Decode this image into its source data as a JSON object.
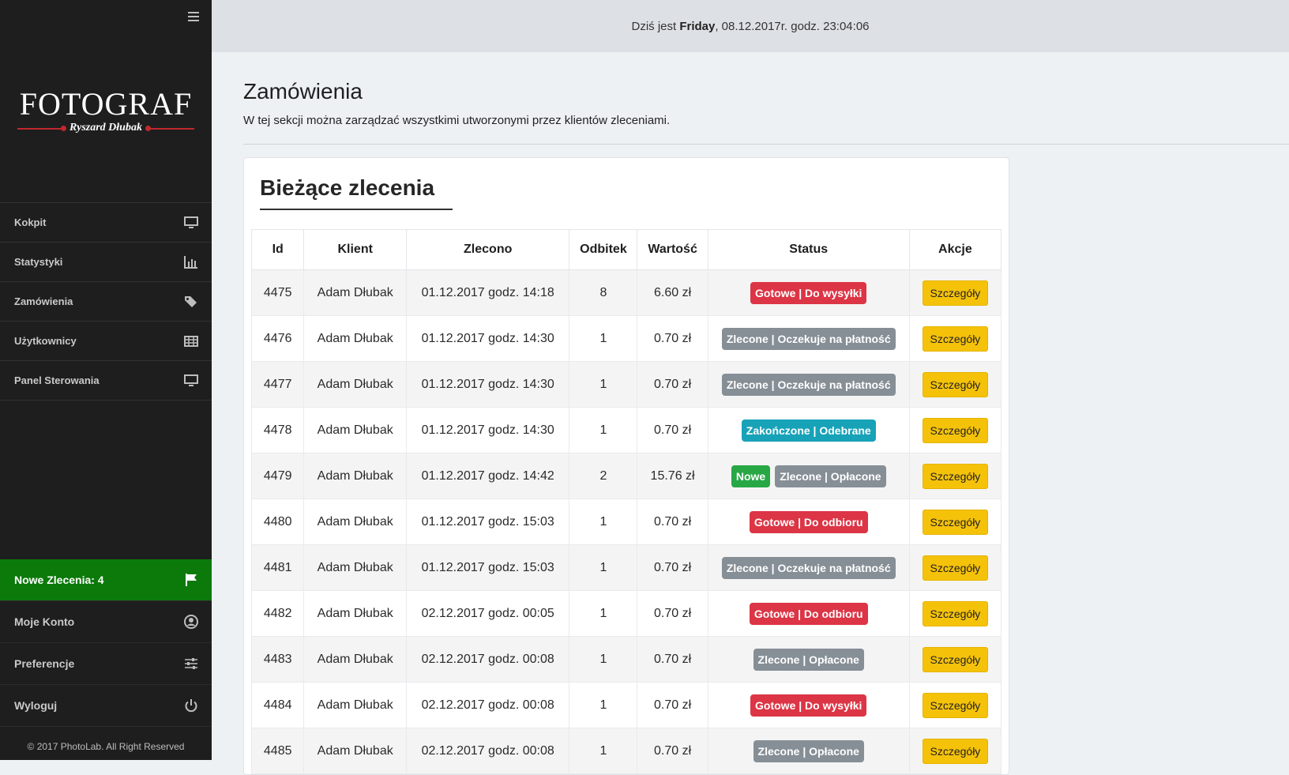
{
  "sidebar": {
    "logo_title": "FOTOGRAF",
    "logo_subtitle": "Ryszard Dłubak",
    "nav": [
      {
        "label": "Kokpit",
        "icon": "monitor-icon"
      },
      {
        "label": "Statystyki",
        "icon": "bar-chart-icon"
      },
      {
        "label": "Zamówienia",
        "icon": "tags-icon"
      },
      {
        "label": "Użytkownicy",
        "icon": "table-icon"
      },
      {
        "label": "Panel Sterowania",
        "icon": "monitor-icon"
      }
    ],
    "bottom": [
      {
        "label": "Nowe Zlecenia: 4",
        "icon": "flag-icon"
      },
      {
        "label": "Moje Konto",
        "icon": "user-circle-icon"
      },
      {
        "label": "Preferencje",
        "icon": "sliders-icon"
      },
      {
        "label": "Wyloguj",
        "icon": "power-icon"
      }
    ],
    "copyright": "© 2017 PhotoLab. All Right Reserved",
    "accent_green": "#0b7a0b"
  },
  "topbar": {
    "prefix": "Dziś jest ",
    "day": "Friday",
    "suffix": ", 08.12.2017r. godz. 23:04:06"
  },
  "main": {
    "title": "Zamówienia",
    "subtitle": "W tej sekcji można zarządzać wszystkimi utworzonymi przez klientów zleceniami."
  },
  "card": {
    "title": "Bieżące zlecenia",
    "columns": [
      "Id",
      "Klient",
      "Zlecono",
      "Odbitek",
      "Wartość",
      "Status",
      "Akcje"
    ],
    "rows": [
      {
        "id": "4475",
        "client": "Adam Dłubak",
        "date": "01.12.2017 godz. 14:18",
        "prints": "8",
        "value": "6.60 zł",
        "statuses": [
          {
            "text": "Gotowe | Do wysyłki",
            "color": "#dc3545"
          }
        ],
        "action": "Szczegóły"
      },
      {
        "id": "4476",
        "client": "Adam Dłubak",
        "date": "01.12.2017 godz. 14:30",
        "prints": "1",
        "value": "0.70 zł",
        "statuses": [
          {
            "text": "Zlecone | Oczekuje na płatność",
            "color": "#868e96"
          }
        ],
        "action": "Szczegóły"
      },
      {
        "id": "4477",
        "client": "Adam Dłubak",
        "date": "01.12.2017 godz. 14:30",
        "prints": "1",
        "value": "0.70 zł",
        "statuses": [
          {
            "text": "Zlecone | Oczekuje na płatność",
            "color": "#868e96"
          }
        ],
        "action": "Szczegóły"
      },
      {
        "id": "4478",
        "client": "Adam Dłubak",
        "date": "01.12.2017 godz. 14:30",
        "prints": "1",
        "value": "0.70 zł",
        "statuses": [
          {
            "text": "Zakończone | Odebrane",
            "color": "#17a2b8"
          }
        ],
        "action": "Szczegóły"
      },
      {
        "id": "4479",
        "client": "Adam Dłubak",
        "date": "01.12.2017 godz. 14:42",
        "prints": "2",
        "value": "15.76 zł",
        "statuses": [
          {
            "text": "Nowe",
            "color": "#28a745"
          },
          {
            "text": "Zlecone | Opłacone",
            "color": "#868e96"
          }
        ],
        "action": "Szczegóły"
      },
      {
        "id": "4480",
        "client": "Adam Dłubak",
        "date": "01.12.2017 godz. 15:03",
        "prints": "1",
        "value": "0.70 zł",
        "statuses": [
          {
            "text": "Gotowe | Do odbioru",
            "color": "#dc3545"
          }
        ],
        "action": "Szczegóły"
      },
      {
        "id": "4481",
        "client": "Adam Dłubak",
        "date": "01.12.2017 godz. 15:03",
        "prints": "1",
        "value": "0.70 zł",
        "statuses": [
          {
            "text": "Zlecone | Oczekuje na płatność",
            "color": "#868e96"
          }
        ],
        "action": "Szczegóły"
      },
      {
        "id": "4482",
        "client": "Adam Dłubak",
        "date": "02.12.2017 godz. 00:05",
        "prints": "1",
        "value": "0.70 zł",
        "statuses": [
          {
            "text": "Gotowe | Do odbioru",
            "color": "#dc3545"
          }
        ],
        "action": "Szczegóły"
      },
      {
        "id": "4483",
        "client": "Adam Dłubak",
        "date": "02.12.2017 godz. 00:08",
        "prints": "1",
        "value": "0.70 zł",
        "statuses": [
          {
            "text": "Zlecone | Opłacone",
            "color": "#868e96"
          }
        ],
        "action": "Szczegóły"
      },
      {
        "id": "4484",
        "client": "Adam Dłubak",
        "date": "02.12.2017 godz. 00:08",
        "prints": "1",
        "value": "0.70 zł",
        "statuses": [
          {
            "text": "Gotowe | Do wysyłki",
            "color": "#dc3545"
          }
        ],
        "action": "Szczegóły"
      },
      {
        "id": "4485",
        "client": "Adam Dłubak",
        "date": "02.12.2017 godz. 00:08",
        "prints": "1",
        "value": "0.70 zł",
        "statuses": [
          {
            "text": "Zlecone | Opłacone",
            "color": "#868e96"
          }
        ],
        "action": "Szczegóły"
      }
    ]
  }
}
